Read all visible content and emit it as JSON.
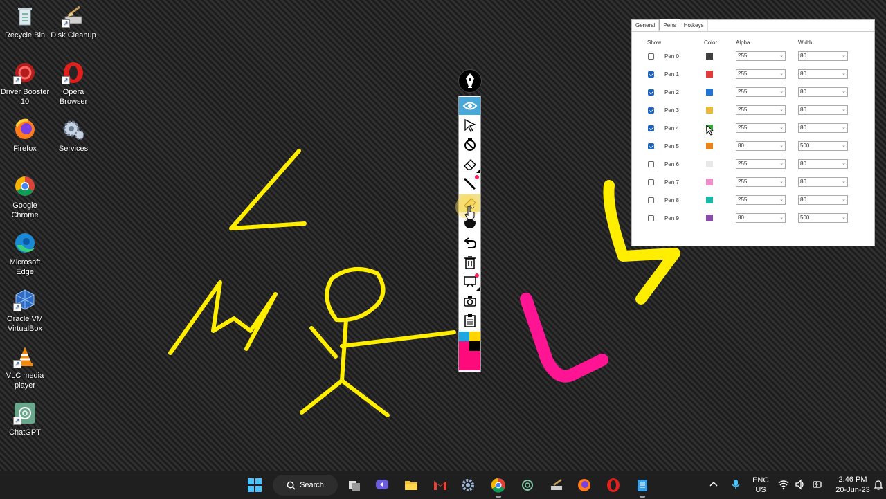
{
  "desktop": {
    "icons": [
      {
        "label": "Recycle Bin"
      },
      {
        "label": "Disk Cleanup"
      },
      {
        "label": "Driver Booster 10"
      },
      {
        "label": "Opera Browser"
      },
      {
        "label": "Firefox"
      },
      {
        "label": "Services"
      },
      {
        "label": "Google Chrome"
      },
      {
        "label": "Microsoft Edge"
      },
      {
        "label": "Oracle VM VirtualBox"
      },
      {
        "label": "VLC media player"
      },
      {
        "label": "ChatGPT"
      }
    ]
  },
  "pen_toolbar": {
    "tools": [
      "visibility-icon",
      "pointer-icon",
      "no-draw-icon",
      "eraser-icon",
      "line-icon",
      "highlighter-icon",
      "color-dot-icon",
      "undo-icon",
      "trash-icon",
      "whiteboard-icon",
      "screenshot-icon",
      "clipboard-icon"
    ],
    "palette": [
      "#1da6e0",
      "#ffd500",
      "#ff0a7a",
      "#000000"
    ]
  },
  "settings": {
    "tabs": [
      "General",
      "Pens",
      "Hotkeys"
    ],
    "selected_tab": "Pens",
    "headers": {
      "show": "Show",
      "color": "Color",
      "alpha": "Alpha",
      "width": "Width"
    },
    "pens": [
      {
        "name": "Pen 0",
        "checked": false,
        "color": "#404040",
        "alpha": "255",
        "width": "80"
      },
      {
        "name": "Pen 1",
        "checked": true,
        "color": "#e03a3a",
        "alpha": "255",
        "width": "80"
      },
      {
        "name": "Pen 2",
        "checked": true,
        "color": "#1f74d4",
        "alpha": "255",
        "width": "80"
      },
      {
        "name": "Pen 3",
        "checked": true,
        "color": "#e8b83a",
        "alpha": "255",
        "width": "80"
      },
      {
        "name": "Pen 4",
        "checked": true,
        "color": "#3aa83a",
        "alpha": "255",
        "width": "80"
      },
      {
        "name": "Pen 5",
        "checked": true,
        "color": "#e8841a",
        "alpha": "80",
        "width": "500"
      },
      {
        "name": "Pen 6",
        "checked": false,
        "color": "#e8e8e8",
        "alpha": "255",
        "width": "80"
      },
      {
        "name": "Pen 7",
        "checked": false,
        "color": "#ec8ec8",
        "alpha": "255",
        "width": "80"
      },
      {
        "name": "Pen 8",
        "checked": false,
        "color": "#1ab8a8",
        "alpha": "255",
        "width": "80"
      },
      {
        "name": "Pen 9",
        "checked": false,
        "color": "#8a4aa8",
        "alpha": "80",
        "width": "500"
      }
    ]
  },
  "taskbar": {
    "search_label": "Search",
    "apps": [
      "windows-start-icon",
      "task-view-icon",
      "chat-icon",
      "file-explorer-icon",
      "gmail-icon",
      "settings-gear-icon",
      "chrome-icon",
      "chatgpt-icon",
      "disk-cleanup-icon",
      "firefox-icon",
      "opera-icon",
      "notepad-icon"
    ],
    "language_top": "ENG",
    "language_bottom": "US",
    "time": "2:46 PM",
    "date": "20-Jun-23"
  },
  "colors": {
    "yellow_ink": "#ffee00",
    "pink_ink": "#ff1493",
    "accent": "#1a63c7"
  }
}
